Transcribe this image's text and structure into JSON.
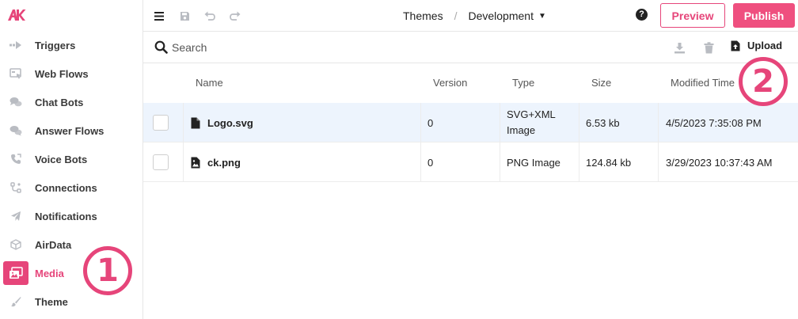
{
  "brand": {
    "accent": "#e6457a",
    "publish_bg": "#ef4f7f",
    "selected_row_bg": "#edf4fd"
  },
  "sidebar": {
    "logo_text": "AK",
    "items": [
      {
        "label": "Triggers",
        "icon": "trigger-arrow-icon"
      },
      {
        "label": "Web Flows",
        "icon": "web-flow-icon"
      },
      {
        "label": "Chat Bots",
        "icon": "chat-bubbles-icon"
      },
      {
        "label": "Answer Flows",
        "icon": "answer-bubbles-icon"
      },
      {
        "label": "Voice Bots",
        "icon": "phone-icon"
      },
      {
        "label": "Connections",
        "icon": "connections-icon"
      },
      {
        "label": "Notifications",
        "icon": "paper-plane-icon"
      },
      {
        "label": "AirData",
        "icon": "cube-icon"
      },
      {
        "label": "Media",
        "icon": "images-icon",
        "active": true
      },
      {
        "label": "Theme",
        "icon": "brush-icon"
      }
    ]
  },
  "topbar": {
    "breadcrumb_root": "Themes",
    "breadcrumb_separator": "/",
    "breadcrumb_current": "Development",
    "help_label": "?",
    "preview_label": "Preview",
    "publish_label": "Publish"
  },
  "toolbar": {
    "search_placeholder": "Search",
    "upload_label": "Upload"
  },
  "table": {
    "columns": [
      "Name",
      "Version",
      "Type",
      "Size",
      "Modified Time"
    ],
    "rows": [
      {
        "name": "Logo.svg",
        "version": "0",
        "type_line1": "SVG+XML",
        "type_line2": "Image",
        "size": "6.53 kb",
        "modified": "4/5/2023 7:35:08 PM",
        "icon": "file-icon",
        "selected": true
      },
      {
        "name": "ck.png",
        "version": "0",
        "type_line1": "PNG Image",
        "type_line2": "",
        "size": "124.84 kb",
        "modified": "3/29/2023 10:37:43 AM",
        "icon": "image-file-icon",
        "selected": false
      }
    ]
  },
  "annotations": {
    "marker_1": "1",
    "marker_2": "2"
  }
}
